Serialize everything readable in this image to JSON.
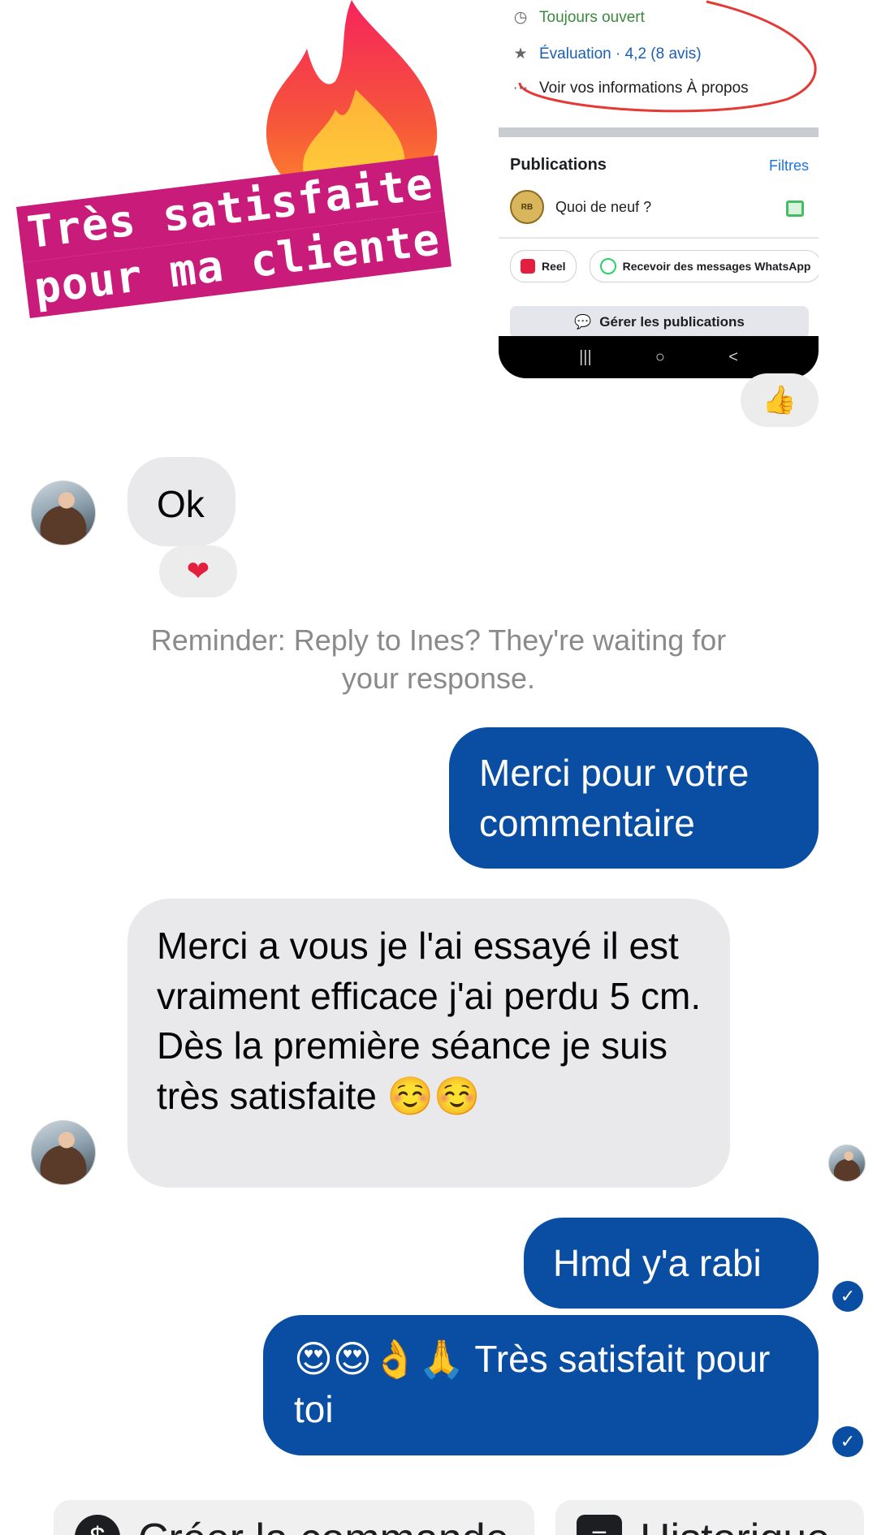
{
  "story": {
    "banner_line1": "Très satisfaite",
    "banner_line2": "pour ma cliente",
    "fire_icon": "fire-emoji",
    "thumb_reaction": "👍",
    "screenshot": {
      "open_status": "Toujours ouvert",
      "rating": "Évaluation · 4,2 (8 avis)",
      "about": "Voir vos informations À propos",
      "publications": "Publications",
      "filters": "Filtres",
      "whats_new": "Quoi de neuf ?",
      "page_avatar_text": "RB",
      "reel": "Reel",
      "whatsapp": "Recevoir des messages WhatsApp",
      "manage": "Gérer les publications",
      "nav": [
        "|||",
        "○",
        "<"
      ]
    }
  },
  "chat": {
    "m1": "Ok",
    "m1_reaction": "❤",
    "reminder": "Reminder: Reply to Ines? They're waiting for your response.",
    "m2": "Merci pour votre commentaire",
    "m3": "Merci a vous je l'ai essayé  il est vraiment efficace j'ai perdu 5 cm. Dès la première séance je suis très satisfaite ☺️☺️",
    "m4": "Hmd y'a rabi",
    "m5": "😍😍👌🙏 Très satisfait pour toi",
    "check": "✓"
  },
  "bottom": {
    "left_label": "Créer la commande",
    "right_label": "Historique"
  },
  "colors": {
    "outgoing": "#0a4ea3",
    "incoming": "#e9e9eb",
    "banner": "#c91b7a"
  }
}
